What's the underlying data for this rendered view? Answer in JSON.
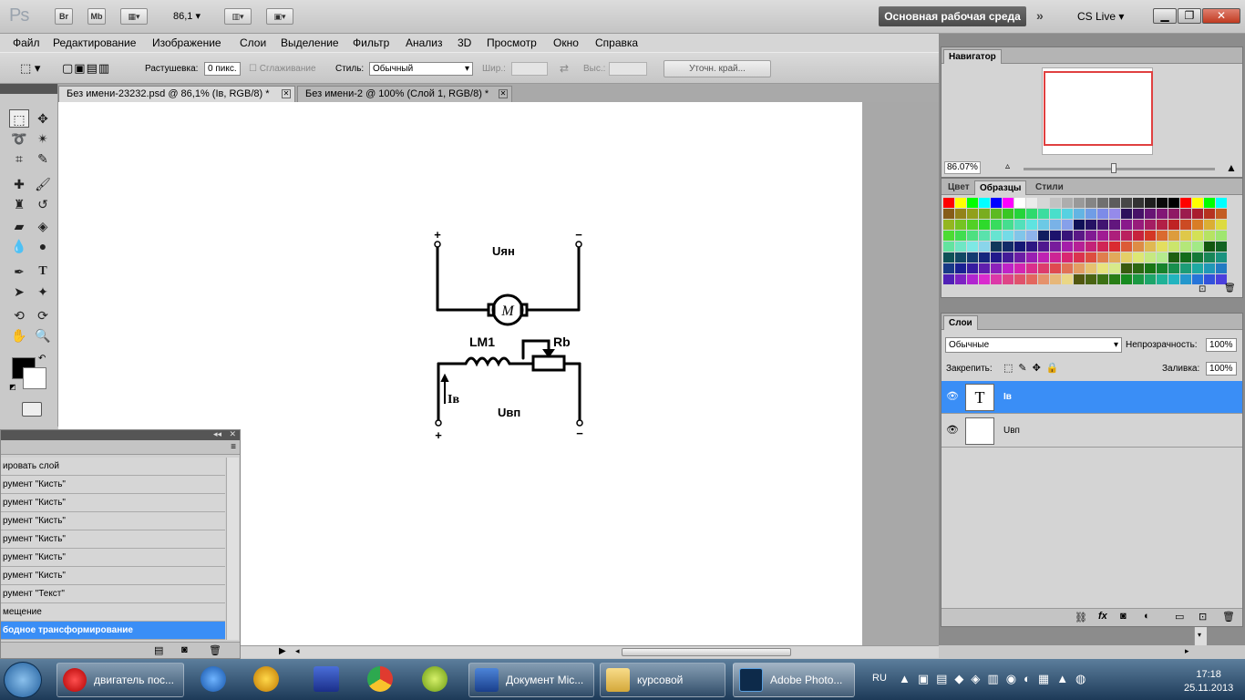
{
  "appbar": {
    "logo": "Ps",
    "br": "Br",
    "mb": "Mb",
    "zoom": "86,1 ▾",
    "workspace": "Основная рабочая среда",
    "cslive": "CS Live ▾"
  },
  "menu": [
    "Файл",
    "Редактирование",
    "Изображение",
    "Слои",
    "Выделение",
    "Фильтр",
    "Анализ",
    "3D",
    "Просмотр",
    "Окно",
    "Справка"
  ],
  "options": {
    "feather_label": "Растушевка:",
    "feather_value": "0 пикс.",
    "antialias_label": "Сглаживание",
    "style_label": "Стиль:",
    "style_value": "Обычный",
    "width_label": "Шир.:",
    "height_label": "Выс.:",
    "refine_label": "Уточн. край..."
  },
  "tabs": [
    {
      "label": "Без имени-23232.psd @ 86,1% (Iв, RGB/8) *"
    },
    {
      "label": "Без имени-2 @ 100% (Слой 1, RGB/8) *"
    }
  ],
  "canvas": {
    "u_anchor": "Uян",
    "motor": "M",
    "lm1": "LM1",
    "rb": "Rb",
    "iv": "Iв",
    "u_field": "Uвп",
    "plus": "+",
    "minus": "−"
  },
  "history": {
    "items": [
      "ировать слой",
      "румент \"Кисть\"",
      "румент \"Кисть\"",
      "румент \"Кисть\"",
      "румент \"Кисть\"",
      "румент \"Кисть\"",
      "румент \"Кисть\"",
      "румент \"Текст\"",
      "мещение",
      "бодное трансформирование"
    ]
  },
  "navigator": {
    "title": "Навигатор",
    "zoom": "86.07%"
  },
  "swatch_panel": {
    "tabs": [
      "Цвет",
      "Образцы",
      "Стили"
    ]
  },
  "layers": {
    "title": "Слои",
    "mode": "Обычные",
    "opacity_label": "Непрозрачность:",
    "opacity": "100%",
    "lock_label": "Закрепить:",
    "fill_label": "Заливка:",
    "fill": "100%",
    "items": [
      {
        "name": "Iв",
        "thumb": "T"
      },
      {
        "name": "Uвп",
        "thumb": ""
      }
    ]
  },
  "taskbar": {
    "items": [
      {
        "label": "двигатель пос..."
      },
      {
        "label": "Документ Mic..."
      },
      {
        "label": "курсовой"
      },
      {
        "label": "Adobe Photo..."
      }
    ],
    "lang": "RU",
    "time": "17:18",
    "date": "25.11.2013"
  },
  "colors": {
    "accent": "#3a8ef6",
    "workspace_bg": "#4a4a4a"
  }
}
